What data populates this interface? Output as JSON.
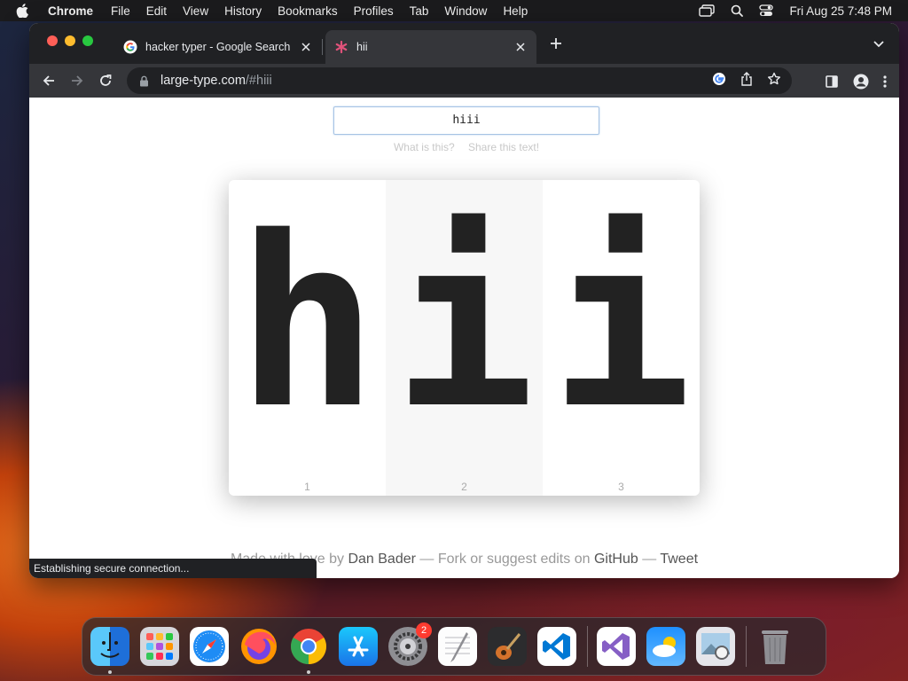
{
  "menubar": {
    "app_name": "Chrome",
    "items": [
      "File",
      "Edit",
      "View",
      "History",
      "Bookmarks",
      "Profiles",
      "Tab",
      "Window",
      "Help"
    ],
    "clock": "Fri Aug 25  7:48 PM"
  },
  "browser": {
    "tabs": [
      {
        "title": "hacker typer - Google Search",
        "favicon": "google-icon",
        "active": false
      },
      {
        "title": "hii",
        "favicon": "asterisk-icon",
        "active": true
      }
    ],
    "url_host": "large-type.com",
    "url_rest": "/#hiii",
    "status_text": "Establishing secure connection..."
  },
  "page": {
    "input_value": "hiii",
    "link_what": "What is this?",
    "link_share": "Share this text!",
    "characters": [
      {
        "char": "h",
        "index": "1"
      },
      {
        "char": "i",
        "index": "2"
      },
      {
        "char": "i",
        "index": "3"
      }
    ],
    "footer": {
      "made_with": "Made with love by",
      "author": "Dan Bader",
      "dash1": "— Fork or suggest edits on",
      "github": "GitHub",
      "dash2": "—",
      "tweet": "Tweet"
    }
  },
  "dock": {
    "apps": [
      "Finder",
      "Launchpad",
      "Safari",
      "Firefox",
      "Chrome",
      "App Store",
      "System Settings",
      "TextEdit",
      "GarageBand",
      "Visual Studio Code",
      "Visual Studio",
      "Weather",
      "Preview",
      "Trash"
    ],
    "settings_badge": "2"
  },
  "colors": {
    "tab_strip": "#202124",
    "toolbar": "#35363a",
    "glyph": "#222222",
    "badge": "#ff3b30"
  }
}
